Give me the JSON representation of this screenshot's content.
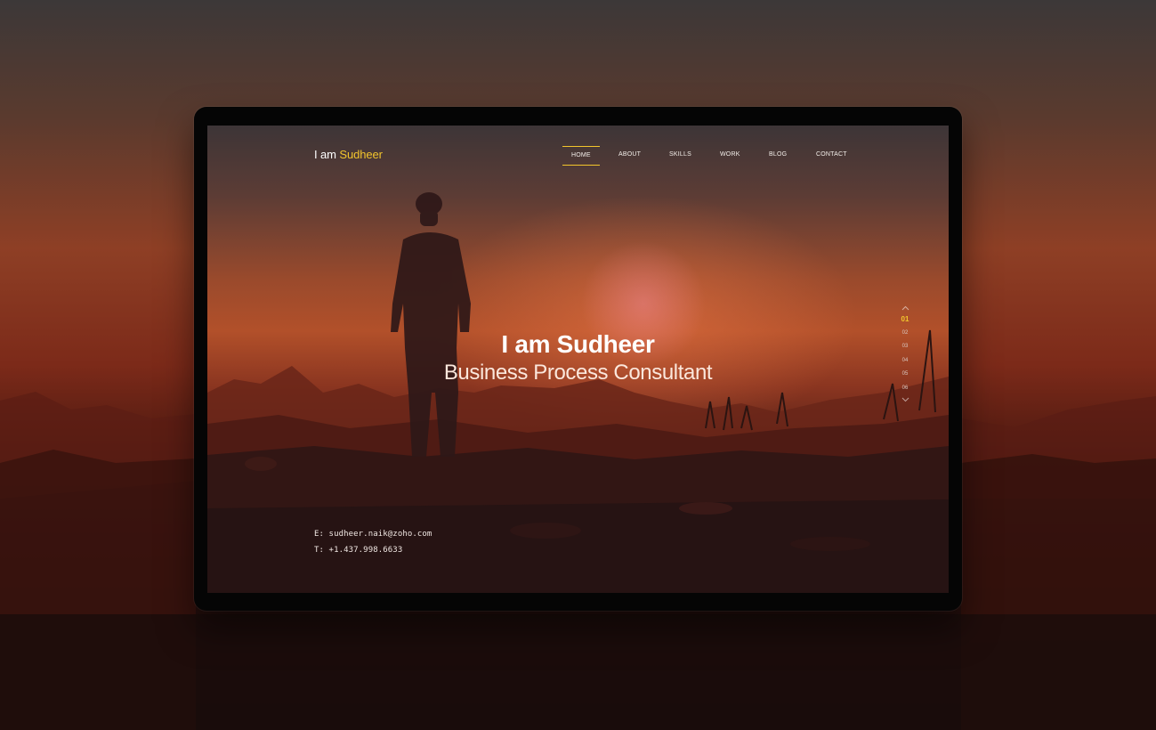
{
  "logo": {
    "prefix": "I am",
    "name": "Sudheer"
  },
  "nav": {
    "items": [
      {
        "label": "HOME",
        "active": true
      },
      {
        "label": "ABOUT",
        "active": false
      },
      {
        "label": "SKILLS",
        "active": false
      },
      {
        "label": "WORK",
        "active": false
      },
      {
        "label": "BLOG",
        "active": false
      },
      {
        "label": "CONTACT",
        "active": false
      }
    ]
  },
  "hero": {
    "title": "I am Sudheer",
    "subtitle": "Business Process Consultant"
  },
  "pager": {
    "up_icon": "chevron-up-icon",
    "down_icon": "chevron-down-icon",
    "items": [
      "01",
      "02",
      "03",
      "04",
      "05",
      "06"
    ],
    "active_index": 0
  },
  "contact": {
    "email": "E: sudheer.naik@zoho.com",
    "phone": "T: +1.437.998.6633"
  },
  "colors": {
    "accent": "#f2c52c",
    "text": "#ffffff"
  }
}
